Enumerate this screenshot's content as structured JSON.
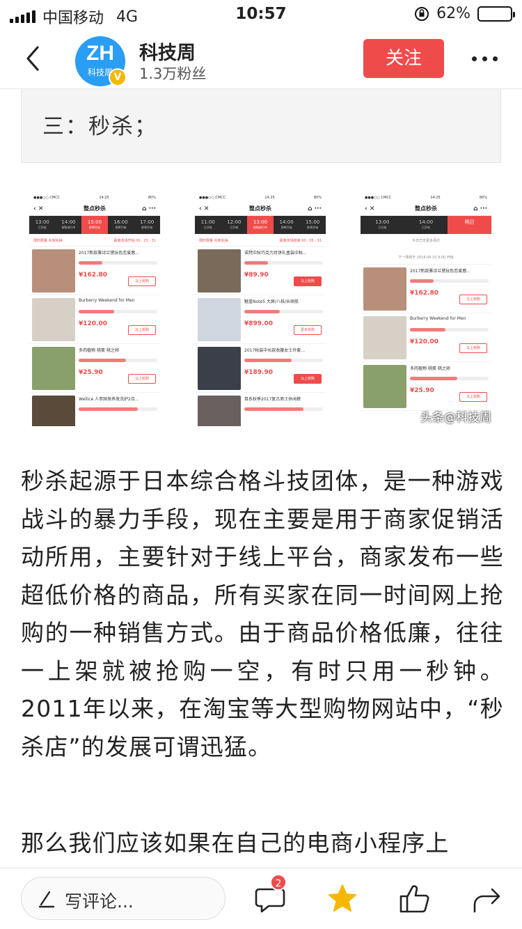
{
  "status_bar": {
    "carrier": "中国移动",
    "network": "4G",
    "time": "10:57",
    "battery_percent": "62%",
    "battery_level": 0.62
  },
  "header": {
    "avatar_text": "ZH",
    "avatar_sub": "科技周",
    "verified_mark": "V",
    "author_name": "科技周",
    "fans": "1.3万粉丝",
    "follow_label": "关注"
  },
  "quote": {
    "text": "三：秒杀；"
  },
  "screenshots": {
    "watermark": "头条@科技周",
    "phones": [
      {
        "carrier": "●●●○○ CMCC",
        "time": "14:25",
        "battery": "80%",
        "nav_title": "整点秒杀",
        "tabs": [
          {
            "time": "13:00",
            "sub": "已开抢"
          },
          {
            "time": "14:00",
            "sub": "抢购进行中"
          },
          {
            "time": "15:00",
            "sub": "即将开始"
          },
          {
            "time": "16:00",
            "sub": "即将开始"
          },
          {
            "time": "17:00",
            "sub": "即将开始"
          }
        ],
        "notice": "限时限量 先到先得",
        "countdown": "距离本场开始 00 : 25 : 31",
        "items": [
          {
            "title": "2017新款雅诗兰黛玩色恋爱唇...",
            "price": "¥162.80",
            "buy": "马上抢购"
          },
          {
            "title": "Burberry Weekend for Men",
            "price": "¥120.00",
            "buy": "马上抢购"
          },
          {
            "title": "多肉植物 桃蛋 桃之卵",
            "price": "¥25.90",
            "buy": "马上抢购"
          },
          {
            "title": "Wellice 人参固发养发洗护2合...",
            "price": "",
            "buy": ""
          }
        ]
      },
      {
        "carrier": "●●●○○ CMCC",
        "time": "14:25",
        "battery": "80%",
        "nav_title": "整点秒杀",
        "tabs": [
          {
            "time": "11:00",
            "sub": "已开抢"
          },
          {
            "time": "12:00",
            "sub": "已开抢"
          },
          {
            "time": "13:00",
            "sub": "抢购进行中"
          },
          {
            "time": "14:00",
            "sub": "即将开始"
          },
          {
            "time": "15:00",
            "sub": "即将开始"
          }
        ],
        "notice": "限时限量 先到先得",
        "countdown": "距离本场结束 00 : 05 : 31",
        "items": [
          {
            "title": "诺梵中秋巧克力月饼礼盒装中秋...",
            "price": "¥89.90",
            "buy": "马上抢购"
          },
          {
            "title": "魅蓝Note5 大屏/八核/长续航",
            "price": "¥899.00",
            "buy": "更多抢购"
          },
          {
            "title": "2017秋装中长款收腰女士外套...",
            "price": "¥189.90",
            "buy": "马上抢购"
          },
          {
            "title": "目系秋季2017复古男士休闲裤",
            "price": "",
            "buy": ""
          }
        ]
      },
      {
        "carrier": "●●●○○ CMCC",
        "time": "14:25",
        "battery": "80%",
        "nav_title": "整点秒杀",
        "tabs": [
          {
            "time": "13:00",
            "sub": "已开抢"
          },
          {
            "time": "14:00",
            "sub": "已开抢"
          },
          {
            "time": "明日",
            "sub": ""
          }
        ],
        "notice": "今日已无更多场次",
        "countdown": "下一场将于 2018.04.10 9:00 开抢",
        "items": [
          {
            "title": "2017新款雅诗兰黛玩色恋爱唇...",
            "price": "¥162.80",
            "buy": "马上抢购"
          },
          {
            "title": "Burberry Weekend for Men",
            "price": "¥120.00",
            "buy": "马上抢购"
          },
          {
            "title": "多肉植物 桃蛋 桃之卵",
            "price": "¥25.90",
            "buy": "马上抢购"
          }
        ]
      }
    ]
  },
  "article": {
    "paragraph1": "秒杀起源于日本综合格斗技团体，是一种游戏战斗的暴力手段，现在主要是用于商家促销活动所用，主要针对于线上平台，商家发布一些超低价格的商品，所有买家在同一时间网上抢购的一种销售方式。由于商品价格低廉，往往一上架就被抢购一空，有时只用一秒钟。2011年以来，在淘宝等大型购物网站中，“秒杀店”的发展可谓迅猛。",
    "paragraph2": "那么我们应该如果在自己的电商小程序上"
  },
  "bottom_bar": {
    "comment_placeholder": "写评论...",
    "comment_count": "2"
  }
}
